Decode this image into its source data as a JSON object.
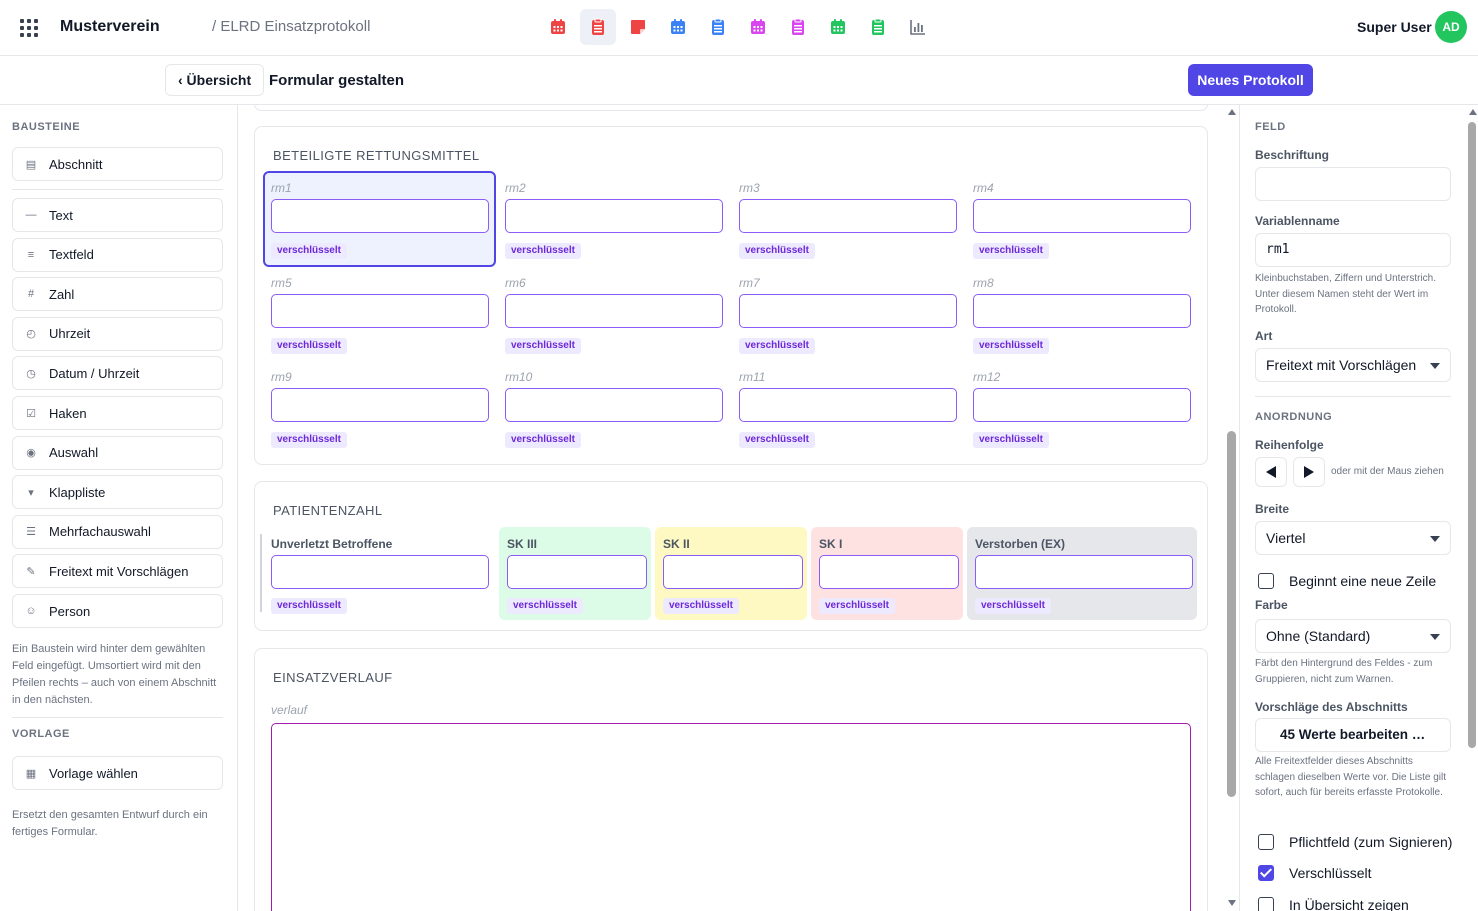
{
  "header": {
    "org_name": "Musterverein",
    "breadcrumb": "/ ELRD Einsatzprotokoll",
    "user_name": "Super User",
    "avatar_initials": "AD",
    "tools": [
      {
        "icon": "calendar-icon",
        "color": "#ef4444"
      },
      {
        "icon": "clipboard-list-icon",
        "color": "#ef4444",
        "active": true
      },
      {
        "icon": "sticky-note-icon",
        "color": "#ef4444"
      },
      {
        "icon": "calendar-icon",
        "color": "#3b82f6"
      },
      {
        "icon": "clipboard-list-icon",
        "color": "#3b82f6"
      },
      {
        "icon": "calendar-icon",
        "color": "#d946ef"
      },
      {
        "icon": "clipboard-list-icon",
        "color": "#d946ef"
      },
      {
        "icon": "calendar-icon",
        "color": "#22c55e"
      },
      {
        "icon": "clipboard-list-icon",
        "color": "#22c55e"
      },
      {
        "icon": "bar-chart-icon",
        "color": "#6b7280"
      }
    ]
  },
  "subheader": {
    "back_label": "‹ Übersicht",
    "title": "Formular gestalten",
    "new_button": "Neues Protokoll"
  },
  "left_panel": {
    "blocks_heading": "BAUSTEINE",
    "section_block": {
      "icon": "▤",
      "label": "Abschnitt"
    },
    "blocks": [
      {
        "icon": "—",
        "label": "Text",
        "name": "text"
      },
      {
        "icon": "≡",
        "label": "Textfeld",
        "name": "textfeld"
      },
      {
        "icon": "#",
        "label": "Zahl",
        "name": "zahl"
      },
      {
        "icon": "◴",
        "label": "Uhrzeit",
        "name": "uhrzeit"
      },
      {
        "icon": "◷",
        "label": "Datum / Uhrzeit",
        "name": "datum-uhrzeit"
      },
      {
        "icon": "☑",
        "label": "Haken",
        "name": "haken"
      },
      {
        "icon": "◉",
        "label": "Auswahl",
        "name": "auswahl"
      },
      {
        "icon": "▾",
        "label": "Klappliste",
        "name": "klappliste"
      },
      {
        "icon": "☰",
        "label": "Mehrfachauswahl",
        "name": "mehrfachauswahl"
      },
      {
        "icon": "✎",
        "label": "Freitext mit Vorschlägen",
        "name": "freitext-vorschlaege"
      },
      {
        "icon": "☺",
        "label": "Person",
        "name": "person"
      }
    ],
    "blocks_hint": "Ein Baustein wird hinter dem gewählten Feld eingefügt. Umsortiert wird mit den Pfeilen rechts – auch von einem Abschnitt in den nächsten.",
    "template_heading": "VORLAGE",
    "template_button": {
      "icon": "▦",
      "label": "Vorlage wählen"
    },
    "template_hint": "Ersetzt den gesamten Entwurf durch ein fertiges Formular."
  },
  "canvas": {
    "sections": {
      "rettungsmittel": {
        "title": "BETEILIGTE RETTUNGSMITTEL",
        "fields": [
          "rm1",
          "rm2",
          "rm3",
          "rm4",
          "rm5",
          "rm6",
          "rm7",
          "rm8",
          "rm9",
          "rm10",
          "rm11",
          "rm12"
        ]
      },
      "patientenzahl": {
        "title": "PATIENTENZAHL",
        "fields": [
          {
            "label": "Unverletzt Betroffene",
            "bg": "#ffffff"
          },
          {
            "label": "SK III",
            "bg": "#dcfce7"
          },
          {
            "label": "SK II",
            "bg": "#fef9c3"
          },
          {
            "label": "SK I",
            "bg": "#fee2e2"
          },
          {
            "label": "Verstorben (EX)",
            "bg": "#e5e7eb"
          }
        ]
      },
      "einsatzverlauf": {
        "title": "EINSATZVERLAUF",
        "field": "verlauf"
      }
    },
    "badge": "verschlüsselt"
  },
  "right_panel": {
    "field_heading": "FELD",
    "caption_label": "Beschriftung",
    "caption_value": "",
    "varname_label": "Variablenname",
    "varname_value": "rm1",
    "varname_hint": "Kleinbuchstaben, Ziffern und Unterstrich. Unter diesem Namen steht der Wert im Protokoll.",
    "type_label": "Art",
    "type_value": "Freitext mit Vorschlägen",
    "layout_heading": "ANORDNUNG",
    "order_label": "Reihenfolge",
    "order_hint": "oder mit der Maus ziehen",
    "width_label": "Breite",
    "width_value": "Viertel",
    "new_row_label": "Beginnt eine neue Zeile",
    "color_label": "Farbe",
    "color_value": "Ohne (Standard)",
    "color_hint": "Färbt den Hintergrund des Feldes - zum Gruppieren, nicht zum Warnen.",
    "suggestions_label": "Vorschläge des Abschnitts",
    "suggestions_button": "45 Werte bearbeiten …",
    "suggestions_hint": "Alle Freitextfelder dieses Abschnitts schlagen dieselben Werte vor. Die Liste gilt sofort, auch für bereits erfasste Protokolle.",
    "required_label": "Pflichtfeld (zum Signieren)",
    "required_checked": false,
    "encrypted_label": "Verschlüsselt",
    "encrypted_checked": true,
    "overview_label": "In Übersicht zeigen",
    "overview_checked": false
  }
}
